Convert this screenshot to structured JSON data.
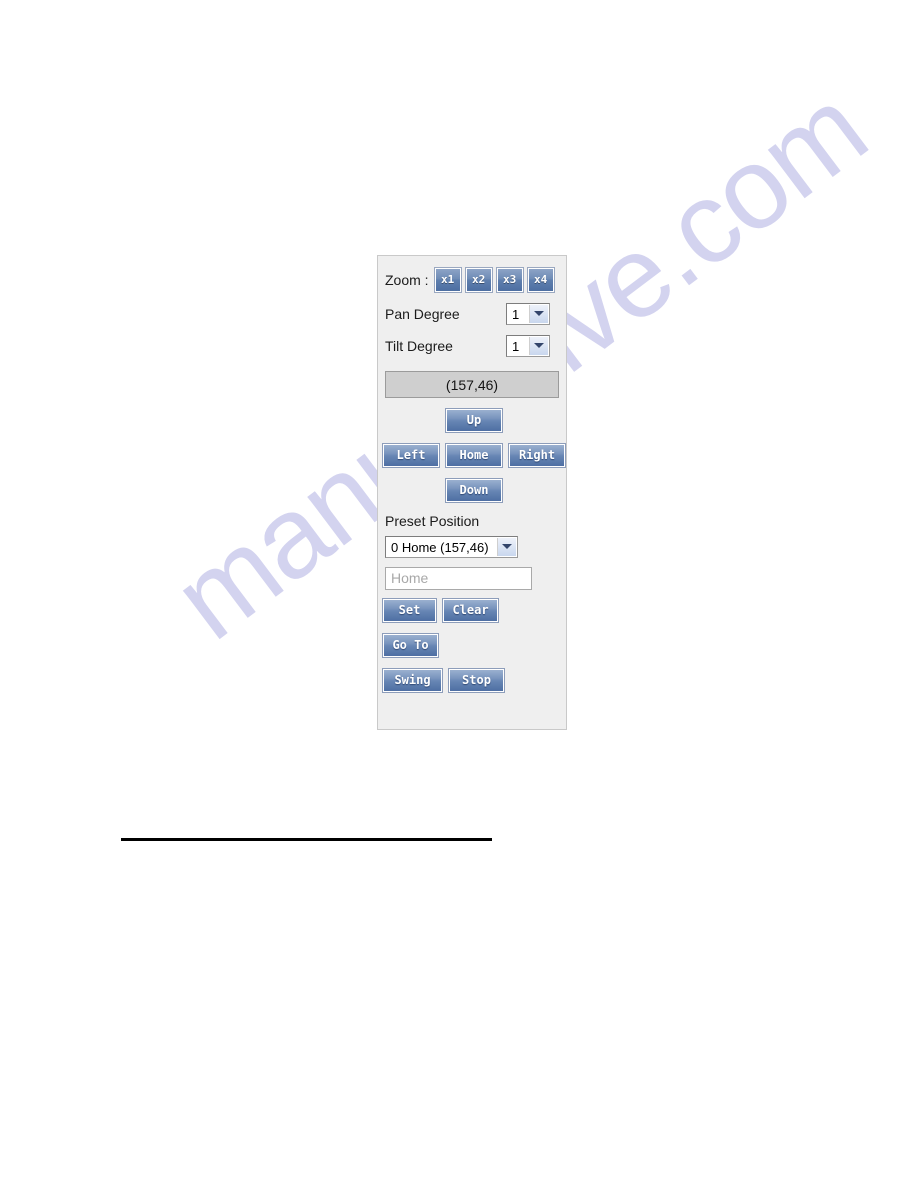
{
  "watermark": {
    "text": "manualslive.com",
    "color": "#d3d3ef"
  },
  "panel": {
    "zoom": {
      "label": "Zoom :",
      "options": [
        "x1",
        "x2",
        "x3",
        "x4"
      ]
    },
    "pan_degree": {
      "label": "Pan Degree",
      "value": "1"
    },
    "tilt_degree": {
      "label": "Tilt Degree",
      "value": "1"
    },
    "position_display": "(157,46)",
    "dpad": {
      "up": "Up",
      "left": "Left",
      "home": "Home",
      "right": "Right",
      "down": "Down"
    },
    "preset": {
      "label": "Preset Position",
      "selected_option": "0 Home (157,46)",
      "name_input_value": "Home",
      "name_input_placeholder": "Home",
      "set": "Set",
      "clear": "Clear",
      "go_to": "Go To",
      "swing": "Swing",
      "stop": "Stop"
    }
  }
}
